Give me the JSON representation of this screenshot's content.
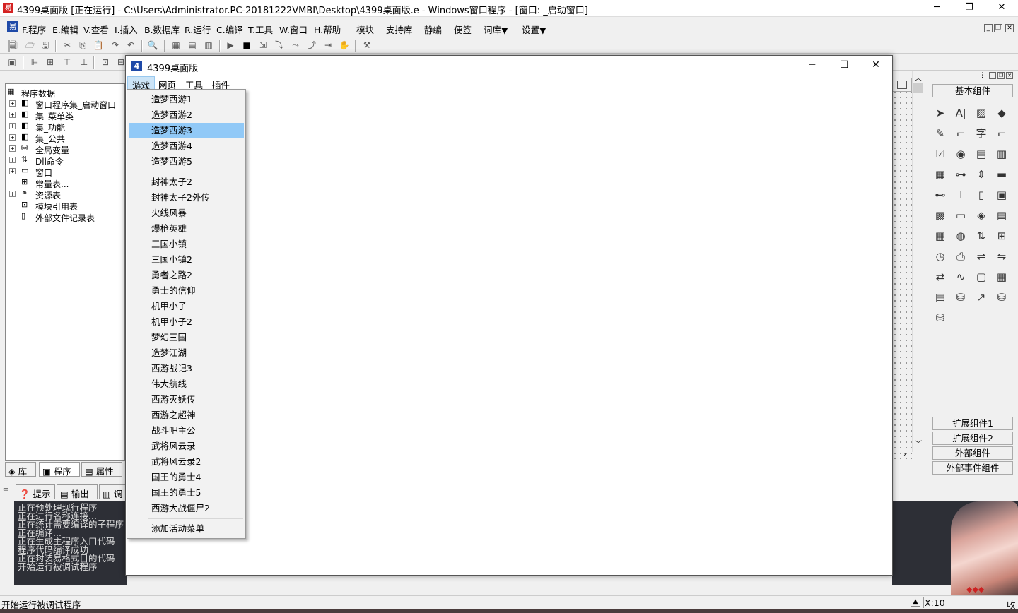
{
  "ide": {
    "title": "4399桌面版 [正在运行] - C:\\Users\\Administrator.PC-20181222VMBI\\Desktop\\4399桌面版.e - Windows窗口程序 - [窗口: _启动窗口]",
    "menu": {
      "program": "F.程序",
      "edit": "E.编辑",
      "view": "V.查看",
      "insert": "I.插入",
      "database": "B.数据库",
      "run": "R.运行",
      "compile": "C.编译",
      "tools": "T.工具",
      "window": "W.窗口",
      "help": "H.帮助",
      "module": "模块",
      "support_lib": "支持库",
      "static_compile": "静编",
      "note": "便签",
      "lexicon": "词库▼",
      "settings": "设置▼"
    },
    "tree": [
      {
        "label": "程序数据",
        "icon": "program-data-icon"
      },
      {
        "label": "窗口程序集_启动窗口",
        "icon": "assembly-icon"
      },
      {
        "label": "集_菜单类",
        "icon": "assembly-icon"
      },
      {
        "label": "集_功能",
        "icon": "assembly-icon"
      },
      {
        "label": "集_公共",
        "icon": "assembly-icon"
      },
      {
        "label": "全局变量",
        "icon": "global-variable-icon"
      },
      {
        "label": "Dll命令",
        "icon": "dll-command-icon"
      },
      {
        "label": "窗口",
        "icon": "window-icon"
      },
      {
        "label": "常量表...",
        "icon": "constant-table-icon"
      },
      {
        "label": "资源表",
        "icon": "resource-table-icon"
      },
      {
        "label": "模块引用表",
        "icon": "module-ref-icon"
      },
      {
        "label": "外部文件记录表",
        "icon": "external-file-icon"
      }
    ],
    "left_tabs": {
      "library": "库",
      "program": "程序",
      "property": "属性"
    },
    "output_tabs": {
      "hint": "提示",
      "output": "输出",
      "debug": "调"
    },
    "output_lines": [
      "正在预处理现行程序",
      "正在进行名称连接...",
      "正在统计需要编译的子程序",
      "正在编译...",
      "正在生成主程序入口代码",
      "程序代码编译成功",
      "正在封装易格式目的代码",
      "开始运行被调试程序"
    ],
    "status": {
      "text": "开始运行被调试程序",
      "x_coord": "X:10",
      "stamp": "收"
    },
    "right_panel": {
      "basic_components": "基本组件",
      "ext_components1": "扩展组件1",
      "ext_components2": "扩展组件2",
      "external_components": "外部组件",
      "external_event_components": "外部事件组件"
    }
  },
  "app": {
    "title": "4399桌面版",
    "menu": {
      "games": "游戏",
      "web": "网页",
      "tools": "工具",
      "plugins": "插件"
    },
    "dropdown": {
      "group1": [
        "造梦西游1",
        "造梦西游2",
        "造梦西游3",
        "造梦西游4",
        "造梦西游5"
      ],
      "group2": [
        "封神太子2",
        "封神太子2外传",
        "火线风暴",
        "爆枪英雄",
        "三国小镇",
        "三国小镇2",
        "勇者之路2",
        "勇士的信仰",
        "机甲小子",
        "机甲小子2",
        "梦幻三国",
        "造梦江湖",
        "西游战记3",
        "伟大航线",
        "西游灭妖传",
        "西游之超神",
        "战斗吧主公",
        "武将风云录",
        "武将风云录2",
        "国王的勇士4",
        "国王的勇士5",
        "西游大战僵尸2"
      ],
      "group3": [
        "添加活动菜单"
      ],
      "highlighted": "造梦西游3"
    }
  }
}
